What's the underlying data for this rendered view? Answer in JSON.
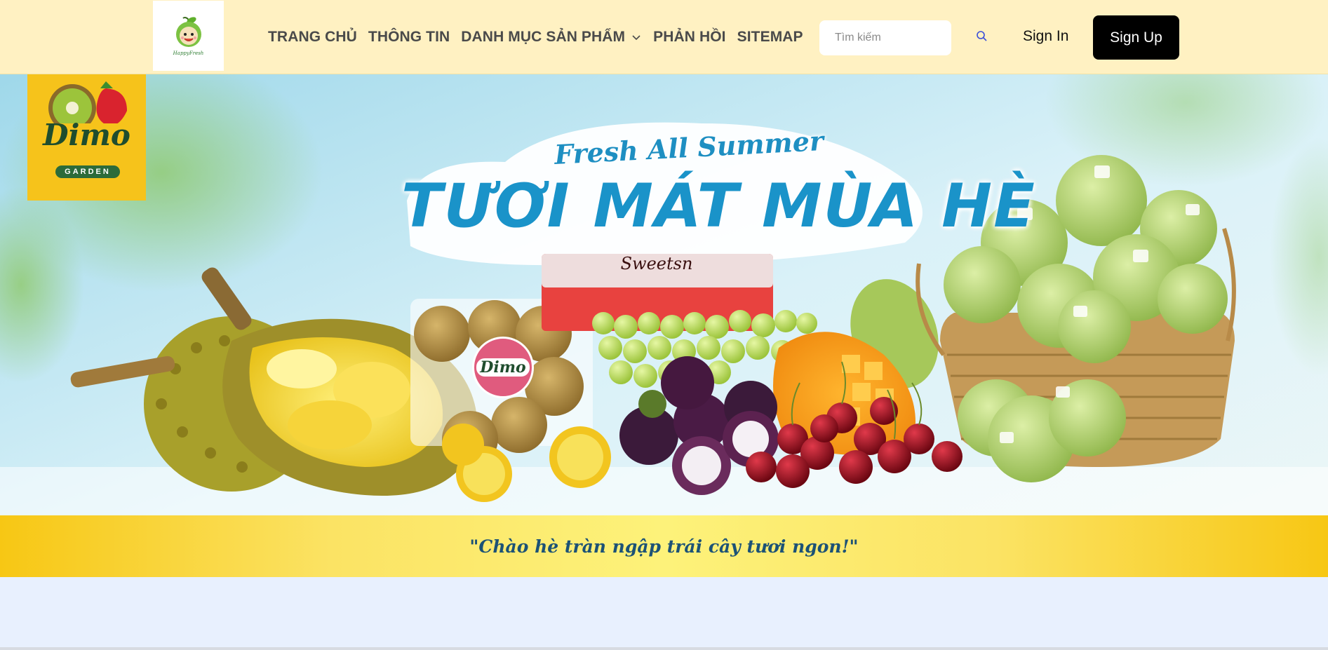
{
  "header": {
    "logo": {
      "icon": "apple-mascot-logo",
      "text": "HappyFresh"
    },
    "nav": [
      {
        "label": "TRANG CHỦ"
      },
      {
        "label": "THÔNG TIN"
      },
      {
        "label": "DANH MỤC SẢN PHẨM",
        "icon": "chevron-down-icon"
      },
      {
        "label": "PHẢN HỒI"
      },
      {
        "label": "SITEMAP"
      }
    ],
    "search": {
      "placeholder": "Tìm kiếm",
      "value": "",
      "icon": "search-icon"
    },
    "signin_label": "Sign In",
    "signup_label": "Sign Up"
  },
  "banner": {
    "badge_title": "Dimo",
    "badge_subtitle": "GARDEN",
    "headline_en": "Fresh All Summer",
    "headline_vi": "TƯƠI MÁT MÙA HÈ",
    "pack_label": "Sweetsn",
    "sticker_text": "Dimo",
    "tagline": "\"Chào hè tràn ngập trái cây tươi ngon!\"",
    "colors": {
      "sky": "#bfe6f2",
      "band": "#f9d93c",
      "headline": "#1a93c9"
    }
  }
}
